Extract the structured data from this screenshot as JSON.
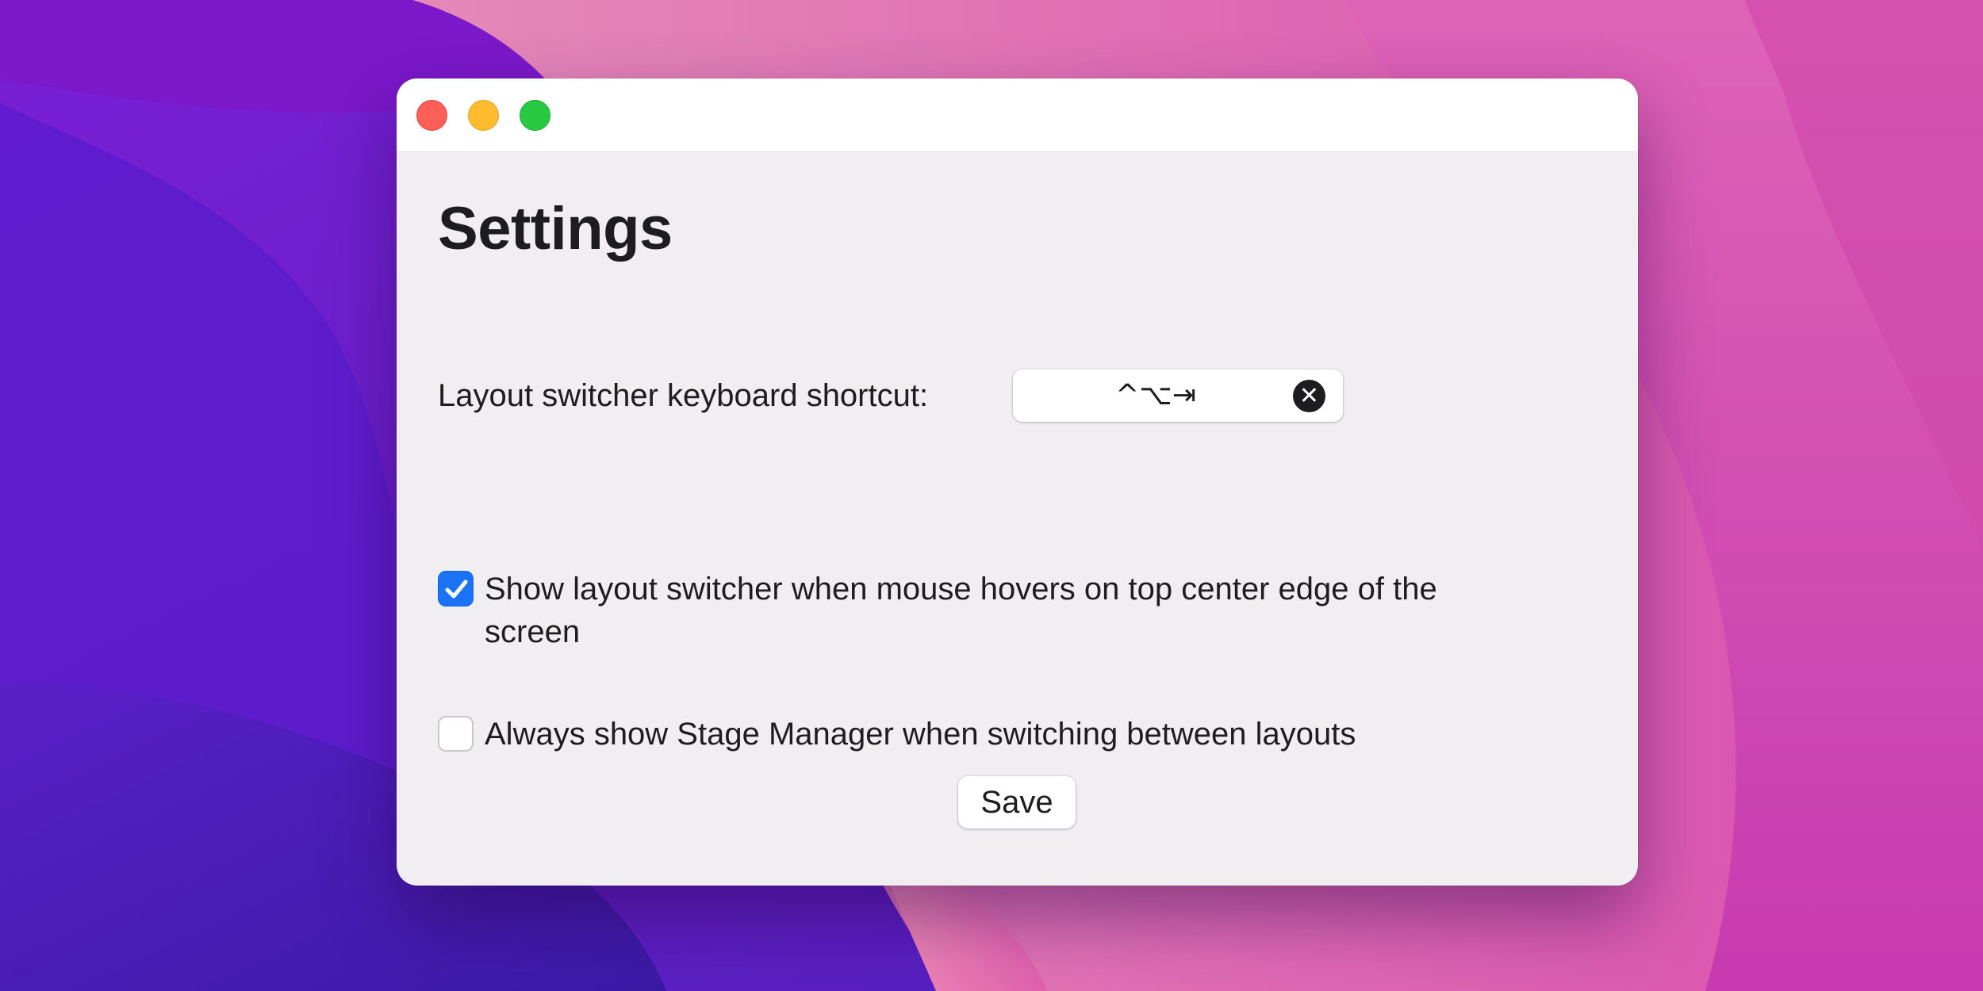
{
  "window": {
    "title": "Settings",
    "controls": {
      "close": "close-button",
      "minimize": "minimize-button",
      "zoom": "zoom-button"
    }
  },
  "shortcut": {
    "label": "Layout switcher keyboard shortcut:",
    "value": "^⌥⇥",
    "clear_icon": "✕"
  },
  "options": [
    {
      "label": "Show layout switcher when mouse hovers on top center edge of the screen",
      "checked": true
    },
    {
      "label": "Always show Stage Manager when switching between layouts",
      "checked": false
    }
  ],
  "actions": {
    "save_label": "Save"
  },
  "colors": {
    "accent": "#1a73f5",
    "close": "#fe5f57",
    "minimize": "#febc2e",
    "zoom": "#28c840",
    "window_bg": "#f0eef1"
  }
}
